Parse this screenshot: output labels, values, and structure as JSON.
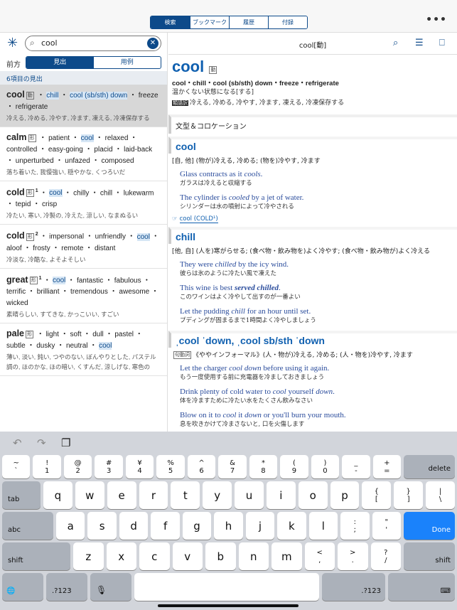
{
  "tabs": [
    "検索",
    "ブックマーク",
    "履歴",
    "付録"
  ],
  "more_icon": "ellipsis-icon",
  "search": {
    "value": "cool",
    "icon": "search-icon"
  },
  "mode": {
    "label": "前方",
    "options": [
      "見出",
      "用例"
    ],
    "selected": "見出"
  },
  "result_count": "6項目の見出",
  "results": [
    {
      "hw": "cool",
      "pos": "動",
      "sup": "",
      "syns": [
        "chill",
        "cool (sb/sth) down",
        "freeze",
        "refrigerate"
      ],
      "hl": [
        0,
        1
      ],
      "ja": "冷える, 冷める, 冷やす, 冷ます, 凍える, 冷凍保存する",
      "selected": true
    },
    {
      "hw": "calm",
      "pos": "形",
      "sup": "",
      "syns": [
        "patient",
        "cool",
        "relaxed",
        "controlled",
        "easy-going",
        "placid",
        "laid-back",
        "unperturbed",
        "unfazed",
        "composed"
      ],
      "hl": [
        1
      ],
      "ja": "落ち着いた, 我慢強い, 穏やかな, くつろいだ"
    },
    {
      "hw": "cold",
      "pos": "形",
      "sup": "1",
      "syns": [
        "cool",
        "chilly",
        "chill",
        "lukewarm",
        "tepid",
        "crisp"
      ],
      "hl": [
        0
      ],
      "ja": "冷たい, 寒い, 冷製の, 冷えた, 涼しい, なまぬるい"
    },
    {
      "hw": "cold",
      "pos": "形",
      "sup": "2",
      "syns": [
        "impersonal",
        "unfriendly",
        "cool",
        "aloof",
        "frosty",
        "remote",
        "distant"
      ],
      "hl": [
        2
      ],
      "ja": "冷淡な, 冷酷な, よそよそしい"
    },
    {
      "hw": "great",
      "pos": "形",
      "sup": "1",
      "syns": [
        "cool",
        "fantastic",
        "fabulous",
        "terrific",
        "brilliant",
        "tremendous",
        "awesome",
        "wicked"
      ],
      "hl": [
        0
      ],
      "ja": "素晴らしい, すてきな, かっこいい, すごい"
    },
    {
      "hw": "pale",
      "pos": "形",
      "sup": "",
      "syns": [
        "light",
        "soft",
        "dull",
        "pastel",
        "subtle",
        "dusky",
        "neutral",
        "cool"
      ],
      "hl": [
        7
      ],
      "ja": "薄い, 淡い, 鈍い, つやのない, ぼんやりとした, パステル調の, ほのかな, ほの暗い, くすんだ, 涼しげな, 寒色の"
    }
  ],
  "entry": {
    "header": "cool[動]",
    "word": "cool",
    "pos": "動",
    "syns": "cool・chill・cool (sb/sth) down・freeze・refrigerate",
    "def": "温かくない状態になる[する]",
    "ruigo_label": "類語訳",
    "ruigo": "冷える, 冷める, 冷やす, 冷ます, 凍える, 冷凍保存する",
    "section": "文型＆コロケーション",
    "subs": [
      {
        "title": "cool",
        "tag": "",
        "sense": "[自, 他] (物が)冷える, 冷める; (物を)冷やす, 冷ます",
        "examples": [
          {
            "en": "Glass contracts as it <i>cools</i>.",
            "ja": "ガラスは冷えると収縮する"
          },
          {
            "en": "The cylinder is <i>cooled</i> by a jet of water.",
            "ja": "シリンダーは水の噴射によって冷やされる"
          }
        ],
        "xref": "cool (COLD¹)"
      },
      {
        "title": "chill",
        "tag": "",
        "sense": "[他, 自] (人を)寒がらせる; (食べ物・飲み物を)よく冷やす; (食べ物・飲み物が)よく冷える",
        "examples": [
          {
            "en": "They were <i>chilled</i> by the icy wind.",
            "ja": "彼らは氷のように冷たい風で凍えた"
          },
          {
            "en": "This wine is best <b><i>served chilled</i></b>.",
            "ja": "このワインはよく冷やして出すのが一番よい"
          },
          {
            "en": "Let the pudding <i>chill</i> for an hour until set.",
            "ja": "プディングが固まるまで1時間よく冷やしましょう"
          }
        ],
        "xref": ""
      },
      {
        "title": "ˌcool ˈdown, ˌcool sb/sth ˈdown",
        "tag": "句動詞",
        "sense": "《ややインフォーマル》(人・物が)冷える, 冷める; (人・物を)冷やす, 冷ます",
        "examples": [
          {
            "en": "Let the charger <i>cool down</i> before using it again.",
            "ja": "もう一度使用する前に充電器を冷ましておきましょう"
          },
          {
            "en": "Drink plenty of cold water to <i>cool</i> yourself <i>down</i>.",
            "ja": "体を冷ますために冷たい水をたくさん飲みなさい"
          },
          {
            "en": "Blow on it to <i>cool</i> it <i>down</i> or you'll burn your mouth.",
            "ja": "息を吹きかけて冷まさないと, 口を火傷します"
          }
        ],
        "xref": ""
      }
    ]
  },
  "keyboard": {
    "row1": [
      [
        "~",
        "`"
      ],
      [
        "!",
        "1"
      ],
      [
        "@",
        "2"
      ],
      [
        "#",
        "3"
      ],
      [
        "¥",
        "4"
      ],
      [
        "%",
        "5"
      ],
      [
        "^",
        "6"
      ],
      [
        "&",
        "7"
      ],
      [
        "*",
        "8"
      ],
      [
        "(",
        "9"
      ],
      [
        ")",
        "0"
      ],
      [
        "_",
        "-"
      ],
      [
        "+",
        "="
      ]
    ],
    "delete": "delete",
    "tab": "tab",
    "abc": "abc",
    "done": "Done",
    "shift": "shift",
    "num": ".?123",
    "row2": [
      "q",
      "w",
      "e",
      "r",
      "t",
      "y",
      "u",
      "i",
      "o",
      "p"
    ],
    "row2b": [
      [
        "{",
        "["
      ],
      [
        "}",
        "]"
      ],
      [
        "|",
        "\\"
      ]
    ],
    "row3": [
      "a",
      "s",
      "d",
      "f",
      "g",
      "h",
      "j",
      "k",
      "l"
    ],
    "row3b": [
      [
        ":",
        ";"
      ],
      [
        "\"",
        "'"
      ]
    ],
    "row4": [
      "z",
      "x",
      "c",
      "v",
      "b",
      "n",
      "m"
    ],
    "row4b": [
      [
        "<",
        ","
      ],
      [
        ">",
        "."
      ],
      [
        "?",
        "/"
      ]
    ],
    "done_color": "#1a82fb"
  }
}
